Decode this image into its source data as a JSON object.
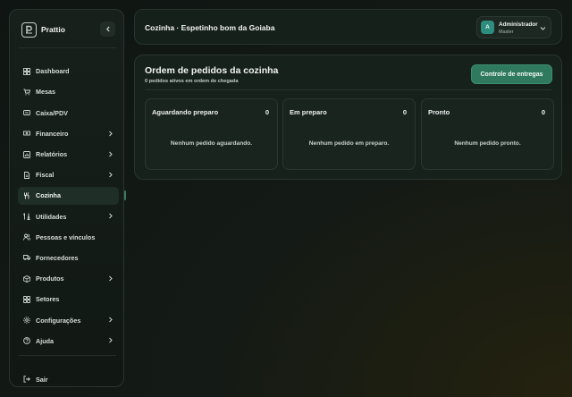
{
  "brand": {
    "name": "Prattio"
  },
  "sidebar": {
    "items": [
      {
        "label": "Dashboard",
        "icon": "dashboard-icon",
        "chevron": false
      },
      {
        "label": "Mesas",
        "icon": "cart-icon",
        "chevron": false
      },
      {
        "label": "Caixa/PDV",
        "icon": "register-icon",
        "chevron": false
      },
      {
        "label": "Financeiro",
        "icon": "money-icon",
        "chevron": true
      },
      {
        "label": "Relatórios",
        "icon": "chart-icon",
        "chevron": true
      },
      {
        "label": "Fiscal",
        "icon": "document-icon",
        "chevron": true
      },
      {
        "label": "Cozinha",
        "icon": "utensils-icon",
        "chevron": false,
        "active": true
      },
      {
        "label": "Utilidades",
        "icon": "tools-icon",
        "chevron": true
      },
      {
        "label": "Pessoas e vínculos",
        "icon": "users-icon",
        "chevron": false
      },
      {
        "label": "Fornecedores",
        "icon": "truck-icon",
        "chevron": false
      },
      {
        "label": "Produtos",
        "icon": "box-icon",
        "chevron": true
      },
      {
        "label": "Setores",
        "icon": "grid-icon",
        "chevron": false
      },
      {
        "label": "Configurações",
        "icon": "gear-icon",
        "chevron": true
      },
      {
        "label": "Ajuda",
        "icon": "help-icon",
        "chevron": true
      }
    ],
    "logout_label": "Sair"
  },
  "header": {
    "title": "Cozinha · Espetinho bom da Goiaba",
    "user": {
      "initial": "A",
      "name": "Administrador",
      "role": "Master"
    }
  },
  "panel": {
    "title": "Ordem de pedidos da cozinha",
    "subtitle": "0 pedidos ativos em ordem de chegada",
    "action_label": "Controle de entregas",
    "columns": [
      {
        "title": "Aguardando preparo",
        "count": "0",
        "empty": "Nenhum pedido aguardando."
      },
      {
        "title": "Em preparo",
        "count": "0",
        "empty": "Nenhum pedido em preparo."
      },
      {
        "title": "Pronto",
        "count": "0",
        "empty": "Nenhum pedido pronto."
      }
    ]
  },
  "colors": {
    "accent": "#2f7a5e",
    "avatar": "#2e8e7e",
    "background": "#0f1512"
  }
}
